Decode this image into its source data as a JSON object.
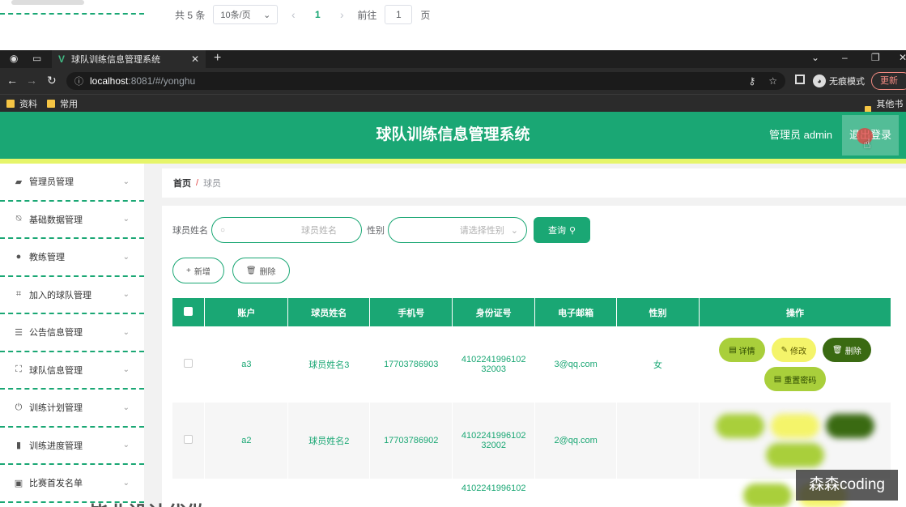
{
  "prev_page": {
    "total": "共 5 条",
    "page_size": "10条/页",
    "current_page": "1",
    "goto_label": "前往",
    "goto_value": "1",
    "page_suffix": "页"
  },
  "browser": {
    "tab_title": "球队训练信息管理系统",
    "url_host": "localhost",
    "url_path": ":8081/#/yonghu",
    "incognito_label": "无痕模式",
    "update_label": "更新",
    "bookmarks": [
      "资料",
      "常用"
    ],
    "other_bookmarks": "其他书签"
  },
  "header": {
    "title": "球队训练信息管理系统",
    "admin": "管理员 admin",
    "logout": "退出登录"
  },
  "sidebar": {
    "items": [
      {
        "label": "管理员管理",
        "icon": "briefcase-icon"
      },
      {
        "label": "基础数据管理",
        "icon": "bell-off-icon"
      },
      {
        "label": "教练管理",
        "icon": "user-icon"
      },
      {
        "label": "加入的球队管理",
        "icon": "crop-icon"
      },
      {
        "label": "公告信息管理",
        "icon": "sliders-icon"
      },
      {
        "label": "球队信息管理",
        "icon": "full-screen-icon"
      },
      {
        "label": "训练计划管理",
        "icon": "power-icon"
      },
      {
        "label": "训练进度管理",
        "icon": "bar-chart-icon"
      },
      {
        "label": "比赛首发名单",
        "icon": "clipboard-icon"
      }
    ]
  },
  "breadcrumb": {
    "home": "首页",
    "sep": "/",
    "current": "球员"
  },
  "search": {
    "name_label": "球员姓名",
    "name_placeholder": "球员姓名",
    "gender_label": "性别",
    "gender_placeholder": "请选择性别",
    "query_button": "查询"
  },
  "actions": {
    "add": "新增",
    "delete": "删除"
  },
  "table": {
    "headers": [
      "账户",
      "球员姓名",
      "手机号",
      "身份证号",
      "电子邮箱",
      "性别",
      "操作"
    ],
    "rows": [
      {
        "account": "a3",
        "name": "球员姓名3",
        "phone": "17703786903",
        "id1": "4102241996102",
        "id2": "32003",
        "email": "3@qq.com",
        "gender": "女"
      },
      {
        "account": "a2",
        "name": "球员姓名2",
        "phone": "17703786902",
        "id1": "4102241996102",
        "id2": "32002",
        "email": "2@qq.com",
        "gender": ""
      },
      {
        "account": "",
        "name": "",
        "phone": "",
        "id1": "4102241996102",
        "id2": "",
        "email": "",
        "gender": ""
      }
    ],
    "ops": {
      "detail": "详情",
      "edit": "修改",
      "delete": "删除",
      "reset": "重置密码"
    }
  },
  "watermark": "森森coding",
  "bottom_text": "毕业设计代做"
}
